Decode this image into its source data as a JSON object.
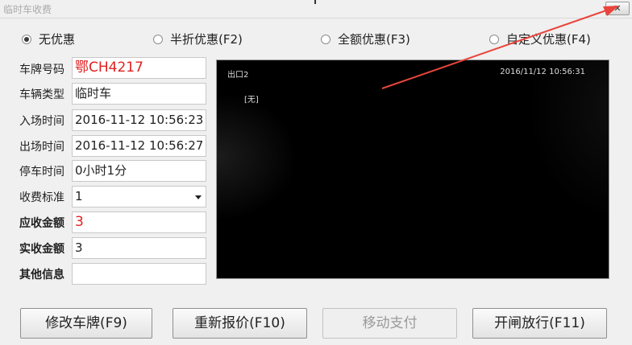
{
  "window": {
    "title": "临时车收费",
    "close_glyph": "✕"
  },
  "discounts": {
    "options": [
      {
        "label": "无优惠",
        "checked": true
      },
      {
        "label": "半折优惠(F2)",
        "checked": false
      },
      {
        "label": "全额优惠(F3)",
        "checked": false
      },
      {
        "label": "自定义优惠(F4)",
        "checked": false
      }
    ]
  },
  "form": {
    "plate": {
      "label": "车牌号码",
      "value": "鄂CH4217"
    },
    "vehicle_type": {
      "label": "车辆类型",
      "value": "临时车"
    },
    "entry_time": {
      "label": "入场时间",
      "value": "2016-11-12 10:56:23"
    },
    "exit_time": {
      "label": "出场时间",
      "value": "2016-11-12 10:56:27"
    },
    "parking_duration": {
      "label": "停车时间",
      "value": "0小时1分"
    },
    "fee_standard": {
      "label": "收费标准",
      "value": "1"
    },
    "amount_due": {
      "label": "应收金额",
      "value": "3"
    },
    "amount_received": {
      "label": "实收金额",
      "value": "3"
    },
    "other_info": {
      "label": "其他信息",
      "value": ""
    }
  },
  "camera": {
    "name": "出口2",
    "timestamp": "2016/11/12  10:56:31",
    "overlay": "[无]"
  },
  "buttons": {
    "edit_plate": "修改车牌(F9)",
    "requote": "重新报价(F10)",
    "mobile_pay": "移动支付",
    "open_gate": "开闸放行(F11)"
  },
  "annotation": {
    "arrow_color": "#e8453c"
  }
}
